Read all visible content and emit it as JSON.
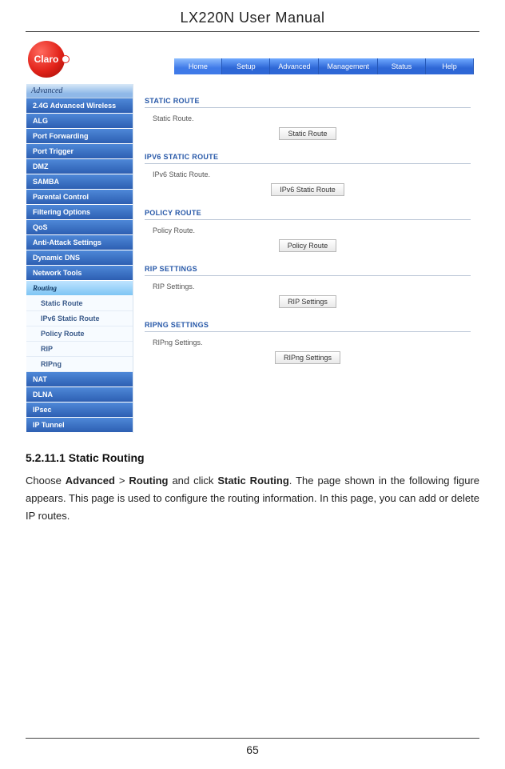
{
  "doc": {
    "title": "LX220N User Manual",
    "page_number": "65",
    "section_heading": "5.2.11.1 Static Routing",
    "paragraph_parts": {
      "p1": "Choose ",
      "b1": "Advanced",
      "p2": " > ",
      "b2": "Routing",
      "p3": " and click ",
      "b3": "Static Routing",
      "p4": ". The page shown in the following figure appears. This page is used to configure the routing information. In this page, you can add or delete IP routes."
    }
  },
  "router": {
    "logo_text": "Claro",
    "topnav": [
      "Home",
      "Setup",
      "Advanced",
      "Management",
      "Status",
      "Help"
    ],
    "sidebar_category": "Advanced",
    "sidebar": [
      {
        "label": "2.4G Advanced Wireless",
        "type": "item"
      },
      {
        "label": "ALG",
        "type": "item"
      },
      {
        "label": "Port Forwarding",
        "type": "item"
      },
      {
        "label": "Port Trigger",
        "type": "item"
      },
      {
        "label": "DMZ",
        "type": "item"
      },
      {
        "label": "SAMBA",
        "type": "item"
      },
      {
        "label": "Parental Control",
        "type": "item"
      },
      {
        "label": "Filtering Options",
        "type": "item"
      },
      {
        "label": "QoS",
        "type": "item"
      },
      {
        "label": "Anti-Attack Settings",
        "type": "item"
      },
      {
        "label": "Dynamic DNS",
        "type": "item"
      },
      {
        "label": "Network Tools",
        "type": "item"
      },
      {
        "label": "Routing",
        "type": "active"
      },
      {
        "label": "Static Route",
        "type": "sub"
      },
      {
        "label": "IPv6 Static Route",
        "type": "sub"
      },
      {
        "label": "Policy Route",
        "type": "sub"
      },
      {
        "label": "RIP",
        "type": "sub"
      },
      {
        "label": "RIPng",
        "type": "sub"
      },
      {
        "label": "NAT",
        "type": "item"
      },
      {
        "label": "DLNA",
        "type": "item"
      },
      {
        "label": "IPsec",
        "type": "item"
      },
      {
        "label": "IP Tunnel",
        "type": "item"
      }
    ],
    "sections": [
      {
        "title": "STATIC ROUTE",
        "body": "Static Route.",
        "button": "Static Route"
      },
      {
        "title": "IPV6 STATIC ROUTE",
        "body": "IPv6 Static Route.",
        "button": "IPv6 Static Route"
      },
      {
        "title": "POLICY ROUTE",
        "body": "Policy Route.",
        "button": "Policy Route"
      },
      {
        "title": "RIP SETTINGS",
        "body": "RIP Settings.",
        "button": "RIP Settings"
      },
      {
        "title": "RIPNG SETTINGS",
        "body": "RIPng Settings.",
        "button": "RIPng Settings"
      }
    ]
  }
}
